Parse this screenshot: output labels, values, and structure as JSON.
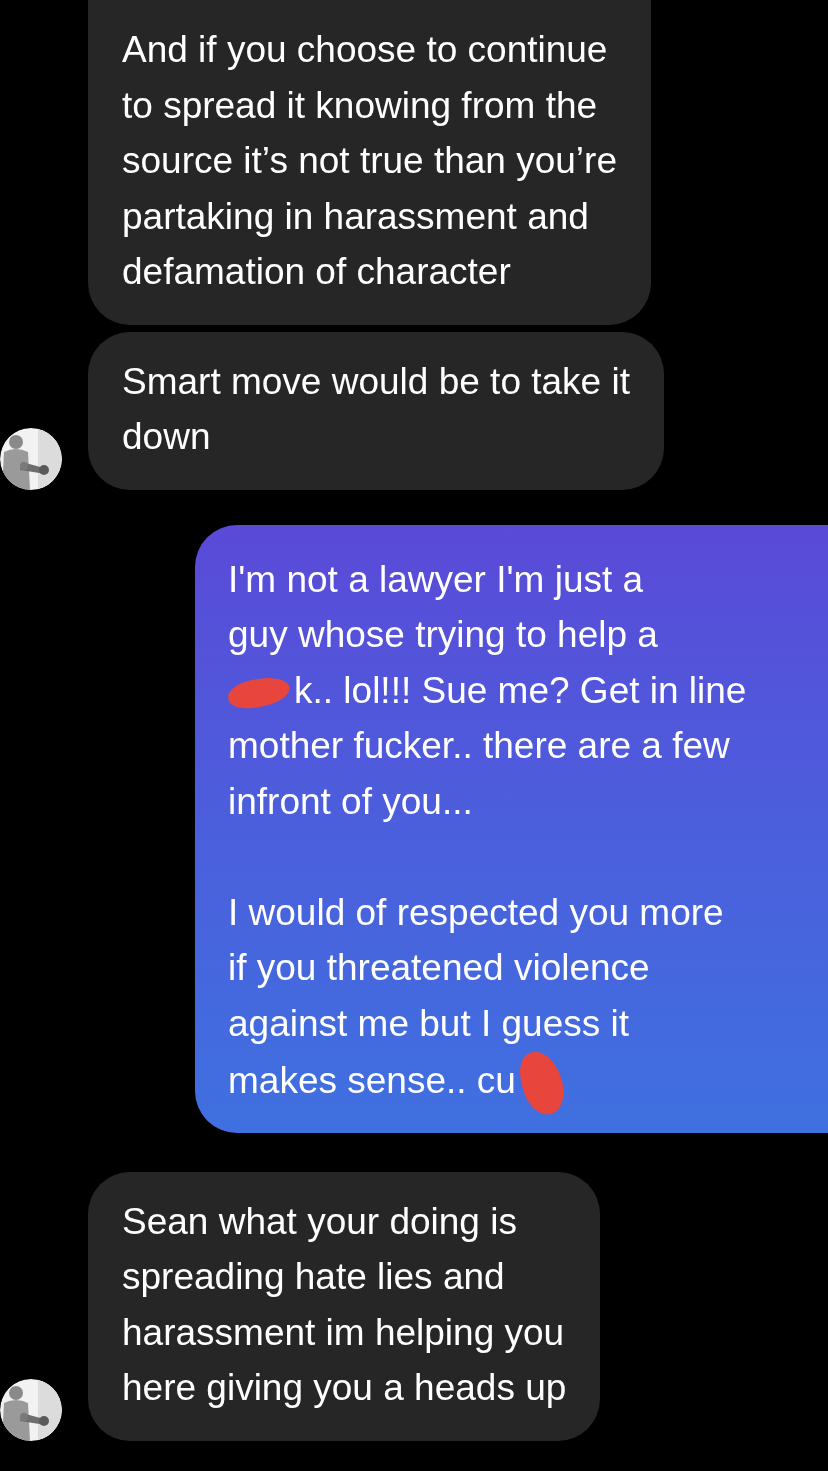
{
  "messages": [
    {
      "kind": "incoming",
      "avatar": false,
      "paragraphs": [
        {
          "lines": [
            {
              "text": "And if you choose to continue"
            },
            {
              "text": "to spread it knowing from the"
            },
            {
              "text": "source it’s not true than you’re"
            },
            {
              "text": "partaking in harassment and"
            },
            {
              "text": "defamation of character"
            }
          ]
        }
      ]
    },
    {
      "kind": "incoming",
      "avatar": true,
      "paragraphs": [
        {
          "lines": [
            {
              "text": "Smart move would be to take it"
            },
            {
              "text": "down"
            }
          ]
        }
      ]
    },
    {
      "kind": "outgoing",
      "paragraphs": [
        {
          "lines": [
            {
              "text": "I'm not a lawyer I'm just a"
            },
            {
              "text": "guy whose trying to help a"
            },
            {
              "kind": "redacted_start",
              "text": "k.. lol!!! Sue me? Get in line"
            },
            {
              "text": "mother fucker.. there are a few"
            },
            {
              "text": "infront of you..."
            }
          ]
        },
        {
          "lines": [
            {
              "text": "I would of respected you more"
            },
            {
              "text": "if you threatened violence"
            },
            {
              "text": "against me but I guess it"
            },
            {
              "kind": "redacted_end",
              "text": "makes sense.. cu"
            }
          ]
        }
      ]
    },
    {
      "kind": "incoming",
      "avatar": true,
      "paragraphs": [
        {
          "lines": [
            {
              "text": "Sean what your doing is"
            },
            {
              "text": "spreading hate lies and"
            },
            {
              "text": "harassment im helping you"
            },
            {
              "text": "here giving you a heads up"
            }
          ]
        }
      ]
    }
  ]
}
